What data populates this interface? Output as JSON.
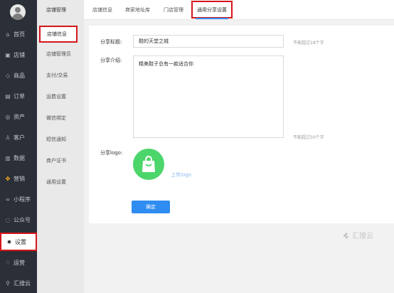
{
  "nav": {
    "items": [
      {
        "label": "首页",
        "icon": "home-icon"
      },
      {
        "label": "店铺",
        "icon": "store-icon"
      },
      {
        "label": "商品",
        "icon": "tag-icon"
      },
      {
        "label": "订单",
        "icon": "order-icon"
      },
      {
        "label": "资产",
        "icon": "coin-icon"
      },
      {
        "label": "客户",
        "icon": "user-icon"
      },
      {
        "label": "数据",
        "icon": "chart-icon"
      },
      {
        "label": "营销",
        "icon": "apps-icon"
      },
      {
        "label": "小程序",
        "icon": "miniprogram-icon"
      },
      {
        "label": "公众号",
        "icon": "wechat-icon"
      },
      {
        "label": "设置",
        "icon": "gear-icon"
      },
      {
        "label": "运营",
        "icon": "operation-icon"
      },
      {
        "label": "汇搜云",
        "icon": "huisouyun-icon"
      }
    ],
    "active": "设置"
  },
  "submenu": {
    "title": "店铺管理",
    "items": [
      "店铺信息",
      "店铺管理员",
      "支付/交易",
      "运费设置",
      "微信绑定",
      "短信通知",
      "商户证书",
      "通用设置"
    ],
    "active": "店铺信息"
  },
  "tabs": [
    "店铺信息",
    "商家地址库",
    "门店管理",
    "通用分享设置"
  ],
  "active_tab": "通用分享设置",
  "form": {
    "title_label": "分享标题:",
    "title_value": "鞋的天堂之城",
    "title_hint": "不能超过18个字",
    "intro_label": "分享介绍:",
    "intro_value": "精美鞋子总有一款适合你",
    "intro_hint": "不能超过50个字",
    "logo_label": "分享logo:",
    "upload_text": "上传logo",
    "confirm_button": "确定"
  },
  "watermark": "汇搜云",
  "colors": {
    "highlight": "#d5151b",
    "primary": "#2f8cf0",
    "logo_green": "#4cd56b",
    "nav_bg": "#2b2f37"
  }
}
